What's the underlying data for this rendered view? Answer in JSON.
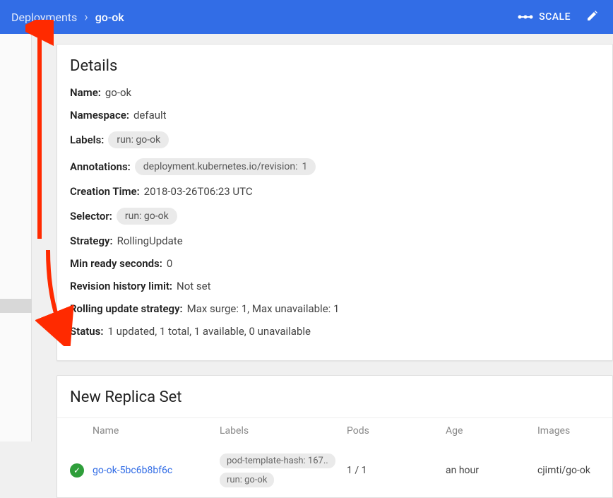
{
  "header": {
    "breadcrumb_root": "Deployments",
    "breadcrumb_current": "go-ok",
    "scale_label": "SCALE"
  },
  "details": {
    "title": "Details",
    "name_label": "Name:",
    "name_value": "go-ok",
    "namespace_label": "Namespace:",
    "namespace_value": "default",
    "labels_label": "Labels:",
    "labels_chip": "run: go-ok",
    "annotations_label": "Annotations:",
    "annotations_chip_key": "deployment.kubernetes.io/revision:",
    "annotations_chip_val": "1",
    "creation_label": "Creation Time:",
    "creation_value": "2018-03-26T06:23 UTC",
    "selector_label": "Selector:",
    "selector_chip": "run: go-ok",
    "strategy_label": "Strategy:",
    "strategy_value": "RollingUpdate",
    "minready_label": "Min ready seconds:",
    "minready_value": "0",
    "revhist_label": "Revision history limit:",
    "revhist_value": "Not set",
    "rolling_label": "Rolling update strategy:",
    "rolling_value": "Max surge: 1, Max unavailable: 1",
    "status_label": "Status:",
    "status_value": "1 updated, 1 total, 1 available, 0 unavailable"
  },
  "replicaset": {
    "title": "New Replica Set",
    "columns": {
      "name": "Name",
      "labels": "Labels",
      "pods": "Pods",
      "age": "Age",
      "images": "Images"
    },
    "row": {
      "name": "go-ok-5bc6b8bf6c",
      "label_chip1": "pod-template-hash: 167..",
      "label_chip2": "run: go-ok",
      "pods": "1 / 1",
      "age": "an hour",
      "images": "cjimti/go-ok"
    }
  }
}
